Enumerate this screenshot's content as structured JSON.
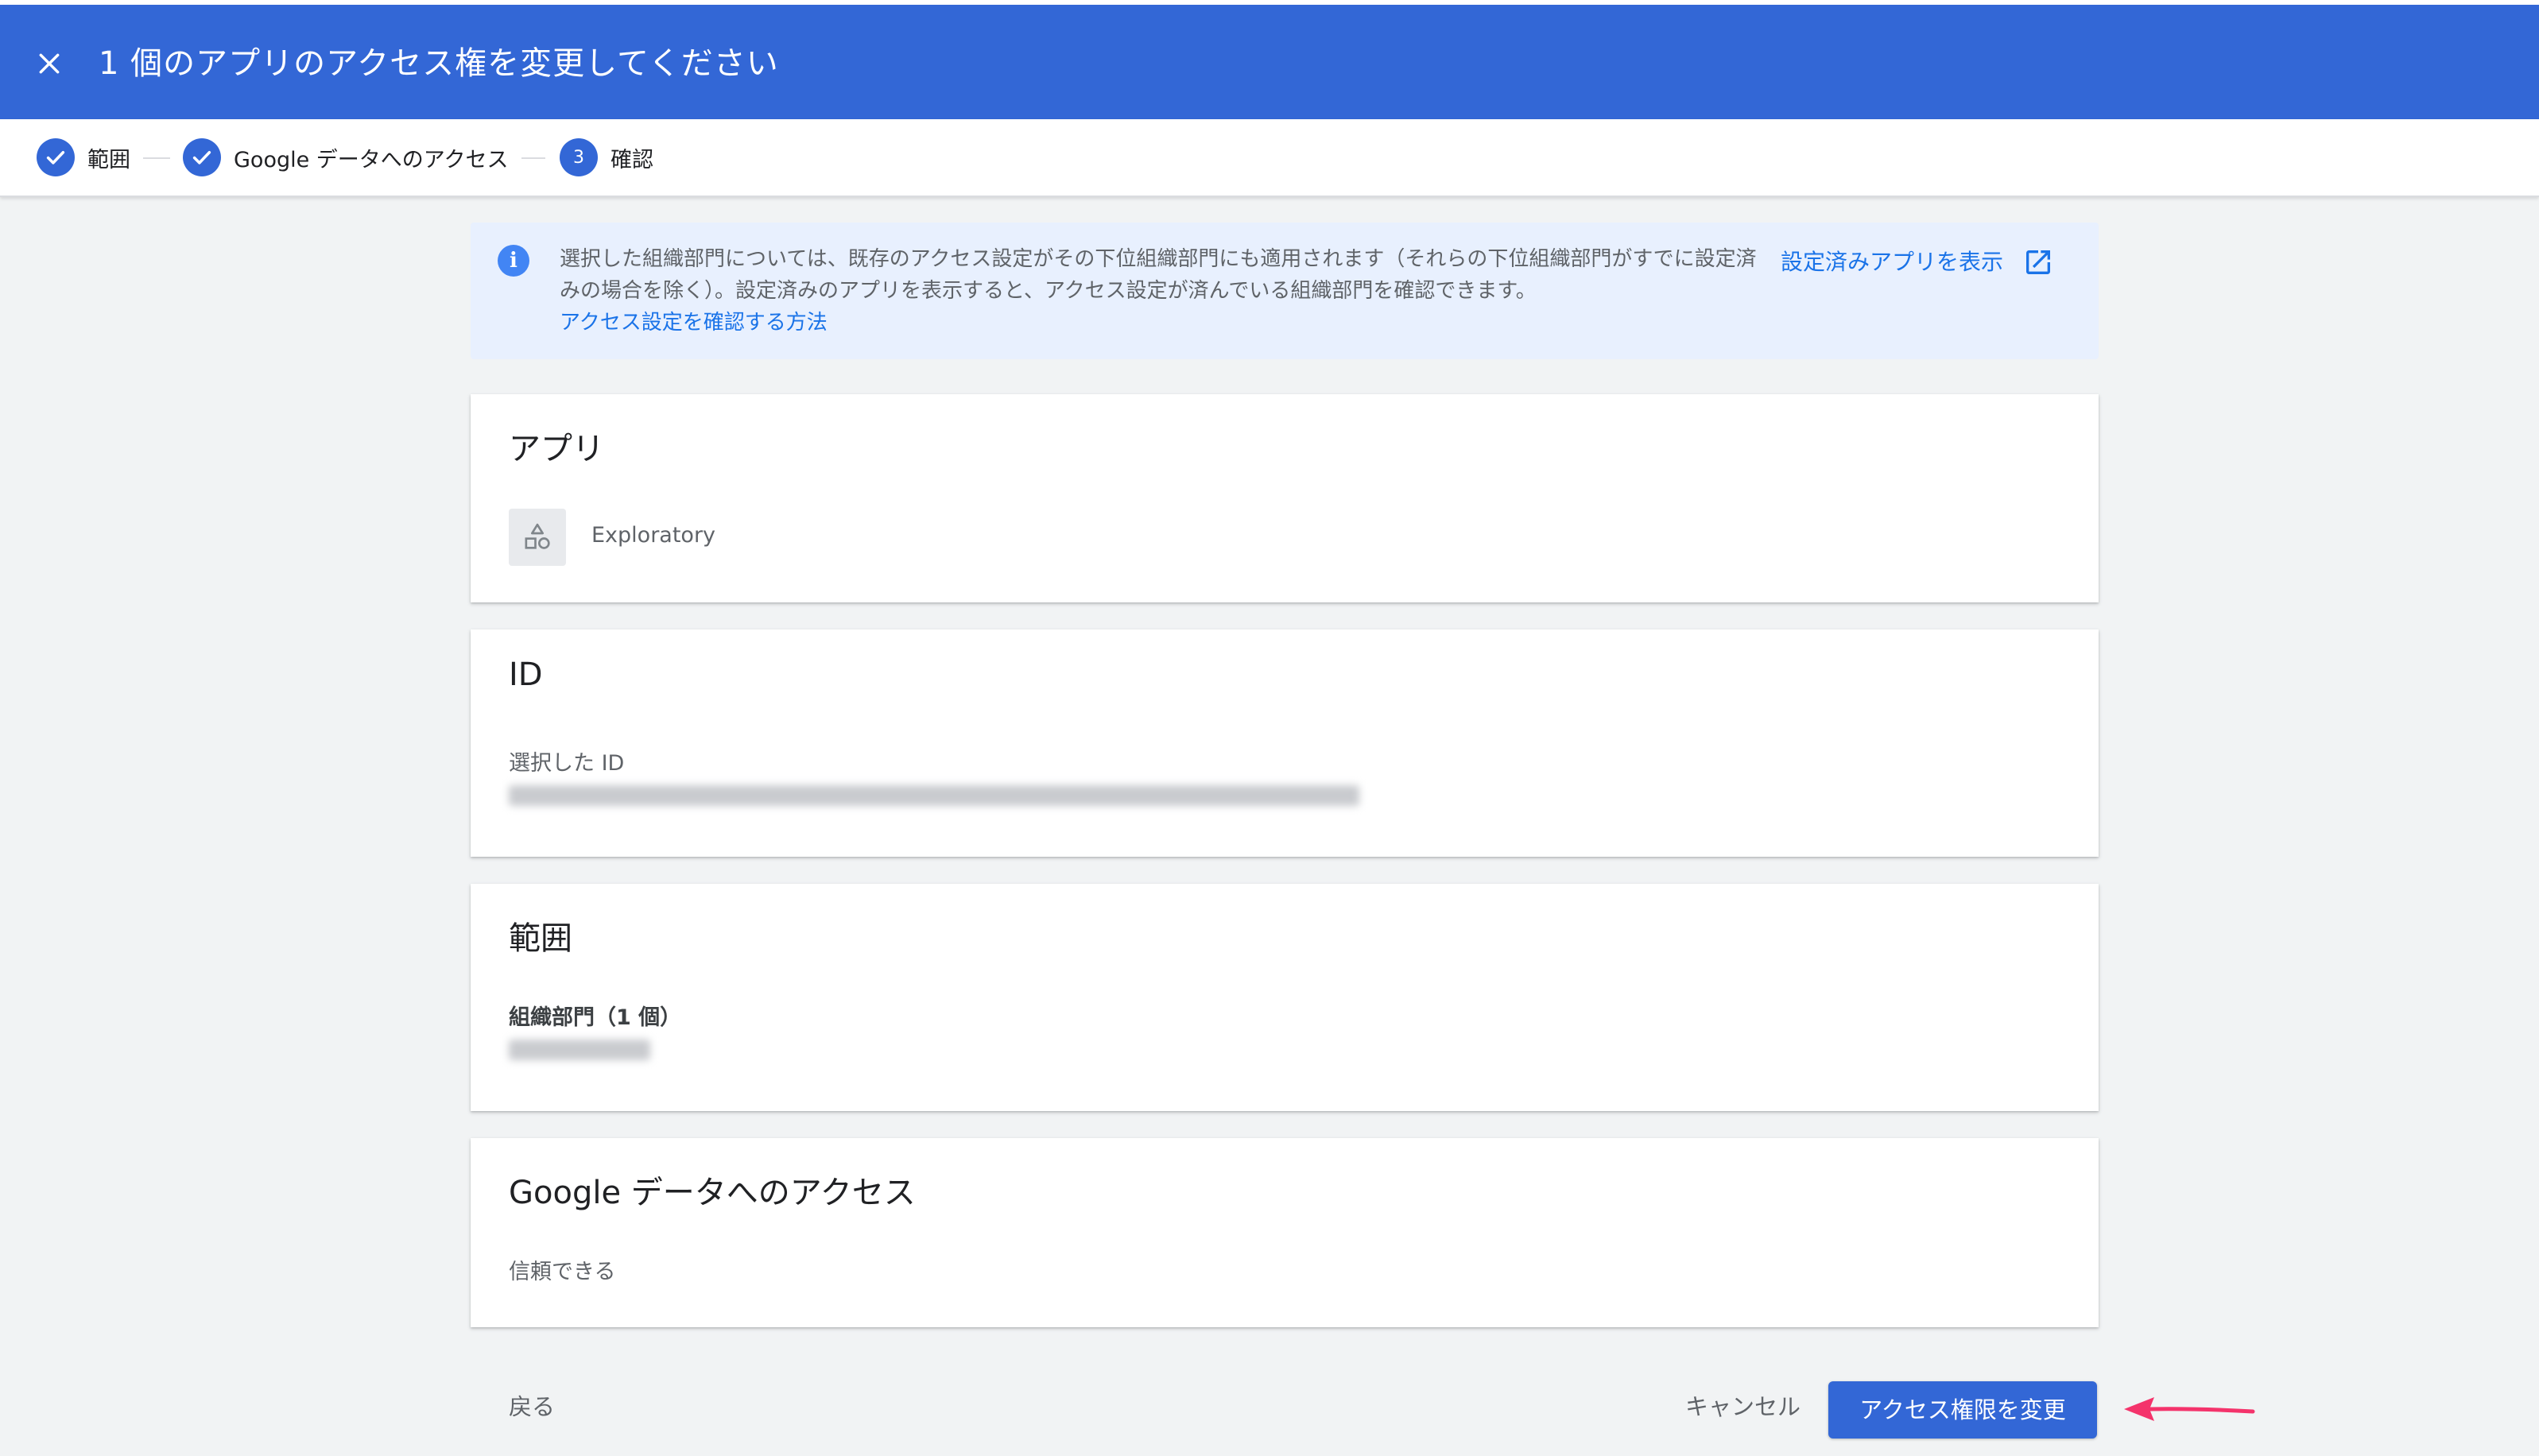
{
  "header": {
    "title": "1 個のアプリのアクセス権を変更してください",
    "close_icon": "close-icon"
  },
  "stepper": {
    "steps": [
      {
        "label": "範囲",
        "state": "done",
        "icon": "check-icon"
      },
      {
        "label": "Google データへのアクセス",
        "state": "done",
        "icon": "check-icon"
      },
      {
        "label": "確認",
        "state": "current",
        "number": "3"
      }
    ]
  },
  "info": {
    "icon": "info-icon",
    "text": "選択した組織部門については、既存のアクセス設定がその下位組織部門にも適用されます（それらの下位組織部門がすでに設定済みの場合を除く）。設定済みのアプリを表示すると、アクセス設定が済んでいる組織部門を確認できます。",
    "link_howto": "アクセス設定を確認する方法",
    "link_view": "設定済みアプリを表示",
    "link_view_icon": "open-in-new-icon"
  },
  "cards": {
    "app": {
      "title": "アプリ",
      "app_name": "Exploratory",
      "app_icon": "shapes-icon"
    },
    "id": {
      "title": "ID",
      "label": "選択した ID"
    },
    "scope": {
      "title": "範囲",
      "label": "組織部門（1 個）"
    },
    "access": {
      "title": "Google データへのアクセス",
      "value": "信頼できる"
    }
  },
  "footer": {
    "back": "戻る",
    "cancel": "キャンセル",
    "submit": "アクセス権限を変更"
  },
  "colors": {
    "header_bg": "#3367d6",
    "accent": "#1a73e8",
    "info_bg": "#e8f0fe",
    "page_bg": "#f1f3f4",
    "annotation_arrow": "#f4336b"
  }
}
